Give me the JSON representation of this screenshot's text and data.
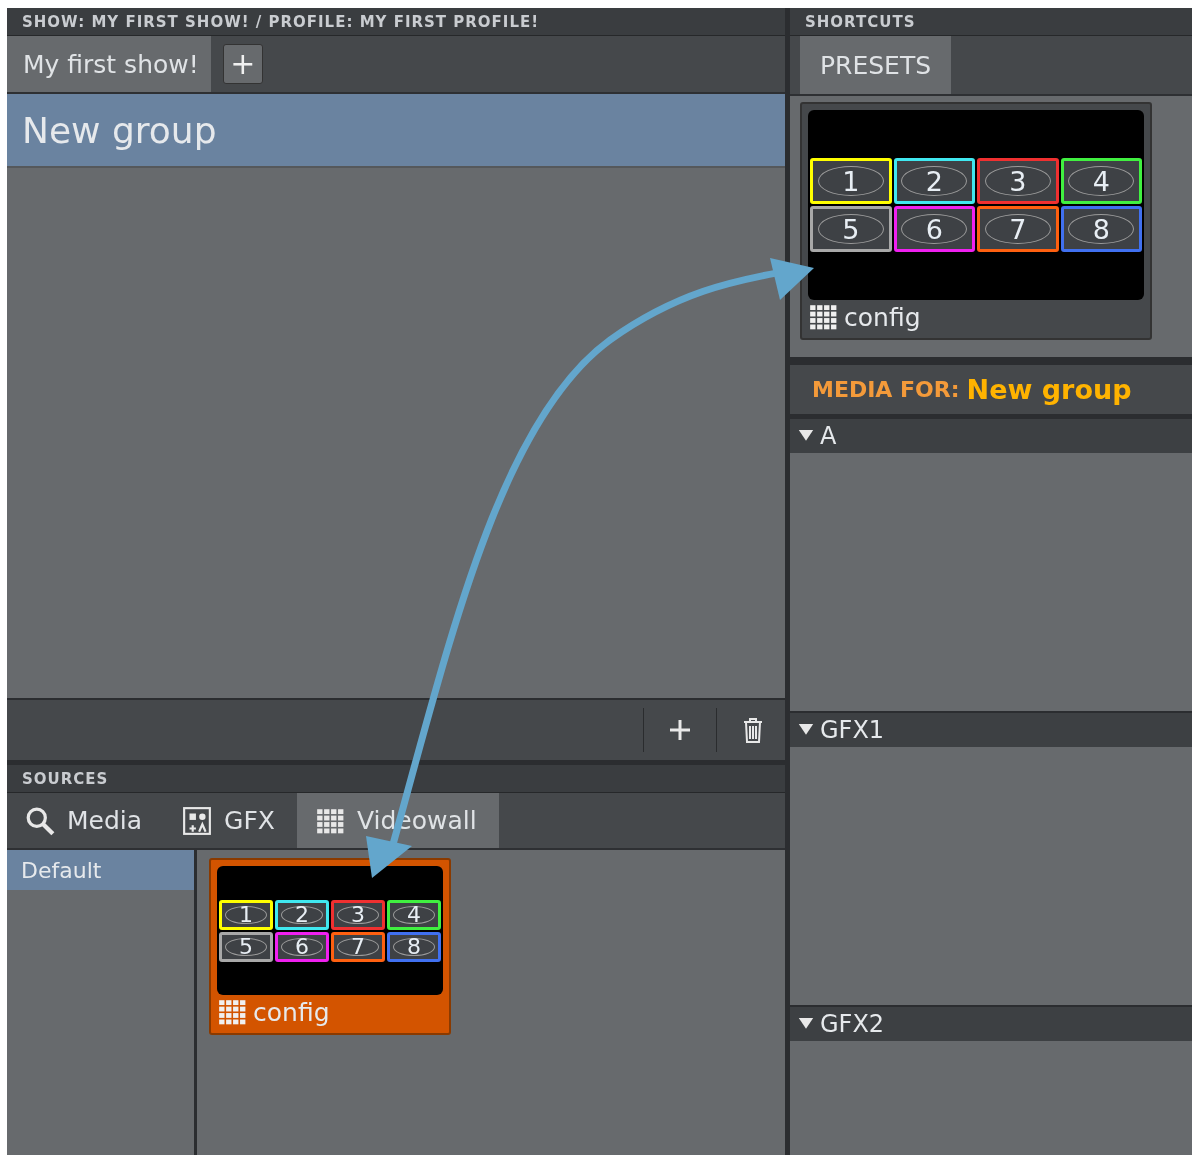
{
  "show_panel": {
    "title": "SHOW: MY FIRST SHOW! / PROFILE: MY FIRST PROFILE!",
    "tabs": [
      {
        "label": "My first show!",
        "selected": true
      }
    ],
    "add_tab": "+",
    "groups": [
      {
        "name": "New group",
        "selected": true
      }
    ]
  },
  "sources": {
    "title": "SOURCES",
    "tabs": [
      {
        "label": "Media",
        "kind": "search",
        "selected": false
      },
      {
        "label": "GFX",
        "kind": "graphics",
        "selected": false
      },
      {
        "label": "Videowall",
        "kind": "videowall",
        "selected": true
      }
    ],
    "categories": [
      {
        "label": "Default",
        "selected": true
      }
    ],
    "items": [
      {
        "label": "config",
        "selected": true,
        "cells": [
          {
            "number": "1",
            "color": "#ffff00"
          },
          {
            "number": "2",
            "color": "#40e8f0"
          },
          {
            "number": "3",
            "color": "#f03030"
          },
          {
            "number": "4",
            "color": "#40f040"
          },
          {
            "number": "5",
            "color": "#a8a8a8"
          },
          {
            "number": "6",
            "color": "#f020f0"
          },
          {
            "number": "7",
            "color": "#ff6010"
          },
          {
            "number": "8",
            "color": "#4070f0"
          }
        ]
      }
    ]
  },
  "shortcuts": {
    "title": "SHORTCUTS",
    "tabs": [
      {
        "label": "PRESETS",
        "selected": true
      }
    ],
    "presets": [
      {
        "label": "config",
        "selected": false,
        "cells": [
          {
            "number": "1",
            "color": "#ffff00"
          },
          {
            "number": "2",
            "color": "#40e8f0"
          },
          {
            "number": "3",
            "color": "#f03030"
          },
          {
            "number": "4",
            "color": "#40f040"
          },
          {
            "number": "5",
            "color": "#a8a8a8"
          },
          {
            "number": "6",
            "color": "#f020f0"
          },
          {
            "number": "7",
            "color": "#ff6010"
          },
          {
            "number": "8",
            "color": "#4070f0"
          }
        ]
      }
    ]
  },
  "media": {
    "prefix": "MEDIA FOR:",
    "group": "New group",
    "sections": [
      {
        "label": "A",
        "expanded": true
      },
      {
        "label": "GFX1",
        "expanded": true
      },
      {
        "label": "GFX2",
        "expanded": true
      }
    ]
  }
}
